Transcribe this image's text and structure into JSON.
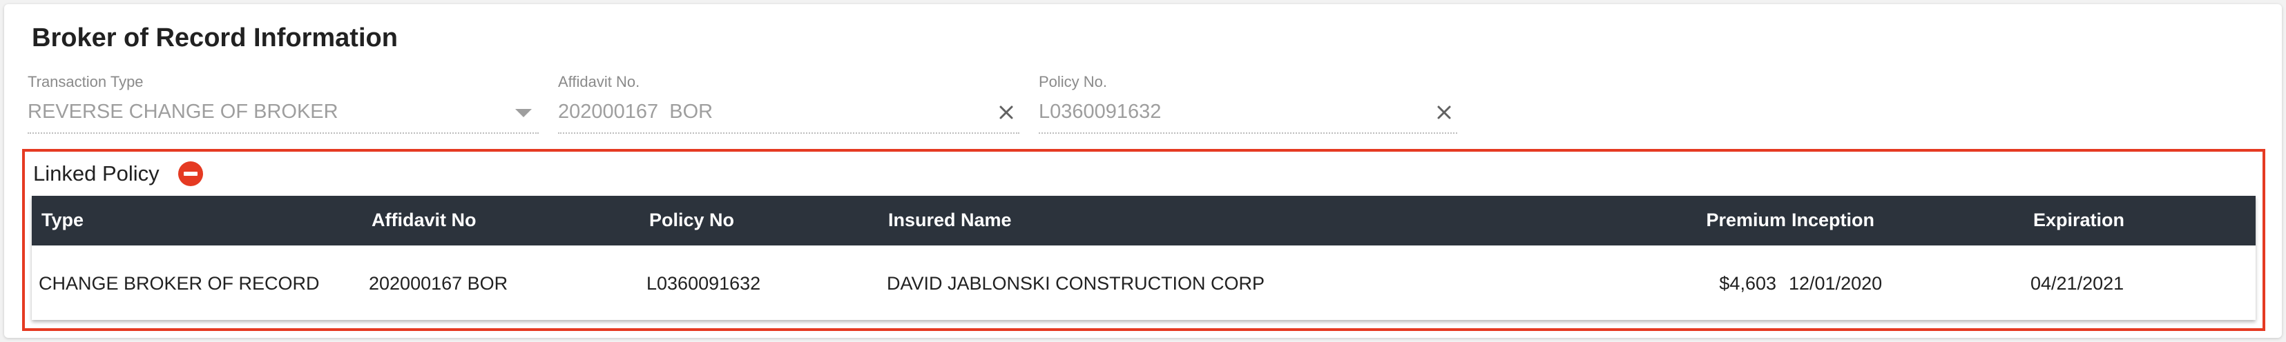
{
  "section_title": "Broker of Record Information",
  "fields": {
    "transaction_type": {
      "label": "Transaction Type",
      "value": "REVERSE CHANGE OF BROKER"
    },
    "affidavit": {
      "label": "Affidavit No.",
      "value": "202000167  BOR"
    },
    "policy": {
      "label": "Policy No.",
      "value": "L0360091632"
    }
  },
  "linked_policy": {
    "title": "Linked Policy",
    "columns": [
      "Type",
      "Affidavit No",
      "Policy No",
      "Insured Name",
      "Premium",
      "Inception",
      "Expiration"
    ],
    "rows": [
      [
        "CHANGE BROKER OF RECORD",
        "202000167 BOR",
        "L0360091632",
        "DAVID JABLONSKI CONSTRUCTION CORP",
        "$4,603",
        "12/01/2020",
        "04/21/2021"
      ]
    ]
  },
  "colors": {
    "accent": "#e53a22",
    "header_bg": "#2c333c"
  }
}
